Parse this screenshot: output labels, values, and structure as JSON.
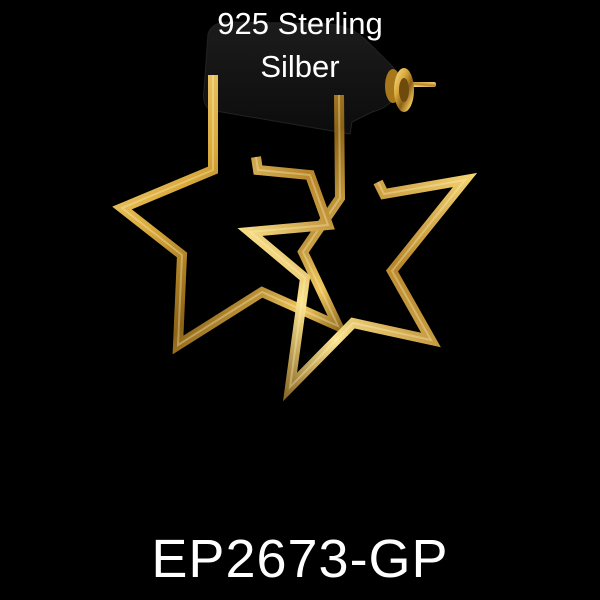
{
  "caption": {
    "line1": "925 Sterling",
    "line2": "Silber"
  },
  "product": {
    "sku": "EP2673-GP"
  },
  "colors": {
    "background": "#000000",
    "text": "#ffffff",
    "gold_highlight": "#fbe38e",
    "gold_mid": "#d9a93c",
    "gold_shadow": "#7a5410",
    "holder": "#141414"
  }
}
